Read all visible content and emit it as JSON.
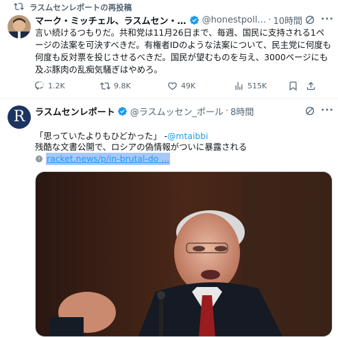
{
  "repost": {
    "label": "ラスムセンレポートの再投稿"
  },
  "post1": {
    "name": "マーク・ミッチェル、ラスムセン・レ…",
    "handle": "@honestpoll…",
    "dot": "·",
    "time": "10時間",
    "text": "言い続けるつもりだ。共和党は11月26日まで、毎週、国民に支持される1ページの法案を可決すべきだ。有権者IDのような法案について、民主党に何度も何度も反対票を投じさせるべきだ。国民が望むものを与え、3000ページにも及ぶ豚肉の乱痴気騒ぎはやめろ。",
    "actions": {
      "replies": "1.2K",
      "reposts": "9.8K",
      "likes": "49K",
      "views": "515K"
    }
  },
  "post2": {
    "avatar_letter": "R",
    "name": "ラスムセンレポート",
    "handle": "@ラスムッセン_ポール",
    "dot": "·",
    "time": "8時間",
    "quote_prefix": "「思っていたよりもひどかった」 -",
    "quote_mention": "@mtaibbi",
    "headline": "残酷な文書公開で、ロシアの偽情報がついに暴露される",
    "link_text": "racket.news/p/in-brutal-do ..."
  },
  "icons": {
    "repost": "repost-icon",
    "verified": "verified-badge-icon",
    "grok": "grok-icon",
    "more": "more-icon",
    "reply": "reply-icon",
    "like": "heart-icon",
    "views": "views-icon",
    "bookmark": "bookmark-icon",
    "share": "share-icon",
    "link": "link-icon"
  },
  "colors": {
    "accent": "#1d9bf0",
    "muted": "#536471",
    "text": "#0f1419",
    "divider": "#eff3f4"
  }
}
